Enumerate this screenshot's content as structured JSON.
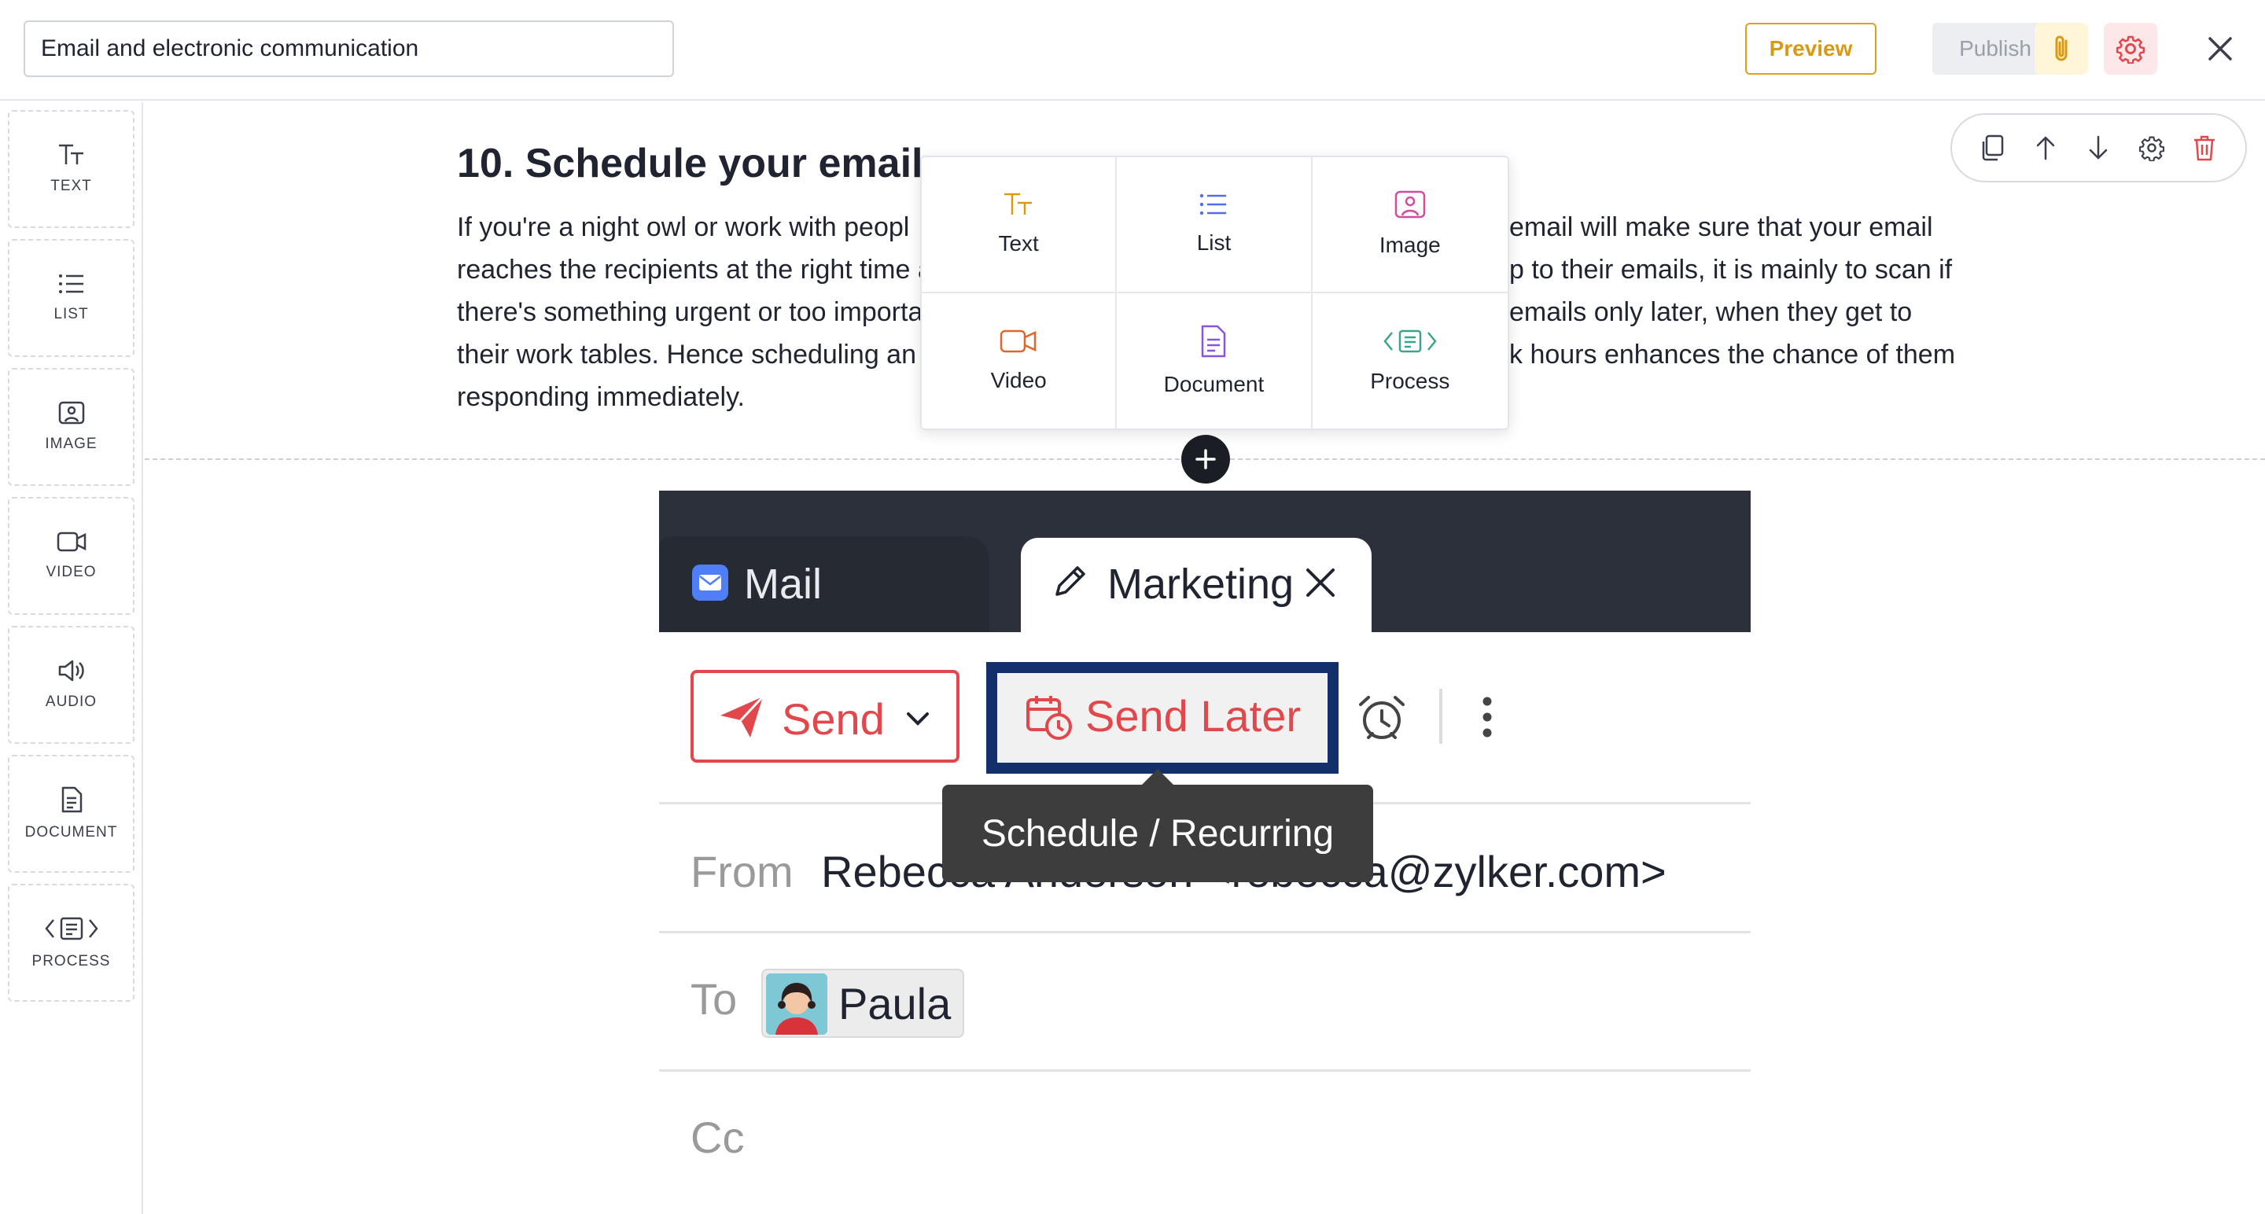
{
  "topbar": {
    "title_value": "Email and electronic communication",
    "preview_label": "Preview",
    "publish_label": "Publish",
    "accent_color": "#e0a11a",
    "danger_color": "#e2484b"
  },
  "sidebar": {
    "items": [
      {
        "label": "TEXT",
        "icon": "text-format-icon"
      },
      {
        "label": "LIST",
        "icon": "list-icon"
      },
      {
        "label": "IMAGE",
        "icon": "image-icon"
      },
      {
        "label": "VIDEO",
        "icon": "video-icon"
      },
      {
        "label": "AUDIO",
        "icon": "audio-icon"
      },
      {
        "label": "DOCUMENT",
        "icon": "document-icon"
      },
      {
        "label": "PROCESS",
        "icon": "process-icon"
      }
    ]
  },
  "content": {
    "heading": "10. Schedule your email",
    "paragraph_lines": [
      "If you're a night owl or work with peopl",
      "reaches the recipients at the right time a",
      "there's something urgent or too importa",
      "their work tables. Hence scheduling an e",
      "responding immediately."
    ],
    "paragraph_right_lines": [
      "email will make sure that your email",
      "p to their emails, it is mainly to scan if",
      "emails only later, when they get to",
      "k hours enhances the chance of them",
      ""
    ]
  },
  "insert_menu": {
    "items": [
      {
        "label": "Text",
        "icon": "text-format-icon"
      },
      {
        "label": "List",
        "icon": "list-icon"
      },
      {
        "label": "Image",
        "icon": "image-icon"
      },
      {
        "label": "Video",
        "icon": "video-icon"
      },
      {
        "label": "Document",
        "icon": "document-icon"
      },
      {
        "label": "Process",
        "icon": "process-icon"
      }
    ]
  },
  "block_toolbar": [
    "copy-icon",
    "arrow-up-icon",
    "arrow-down-icon",
    "gear-icon",
    "trash-icon"
  ],
  "screenshot": {
    "tab_mail": "Mail",
    "tab_marketing": "Marketing",
    "send_label": "Send",
    "send_later_label": "Send Later",
    "tooltip": "Schedule / Recurring",
    "from_label": "From",
    "from_value": "Rebecca Anderson <rebecca@zylker.com>",
    "to_label": "To",
    "to_chip": "Paula",
    "cc_label": "Cc"
  }
}
